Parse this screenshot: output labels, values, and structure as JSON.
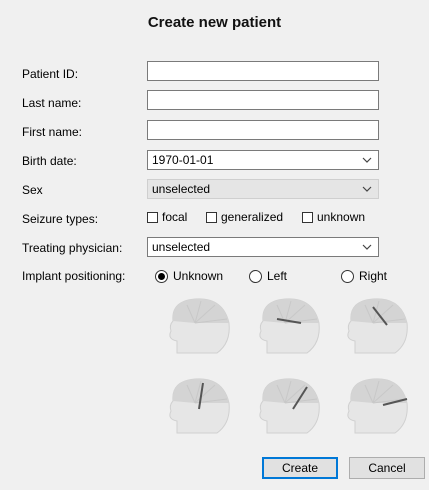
{
  "dialog": {
    "title": "Create new patient"
  },
  "form": {
    "patient_id": {
      "label": "Patient ID:",
      "value": ""
    },
    "last_name": {
      "label": "Last name:",
      "value": ""
    },
    "first_name": {
      "label": "First name:",
      "value": ""
    },
    "birth_date": {
      "label": "Birth date:",
      "value": "1970-01-01"
    },
    "sex": {
      "label": "Sex",
      "value": "unselected"
    },
    "seizure_types": {
      "label": "Seizure types:",
      "options": [
        {
          "label": "focal",
          "checked": false
        },
        {
          "label": "generalized",
          "checked": false
        },
        {
          "label": "unknown",
          "checked": false
        }
      ]
    },
    "treating_physician": {
      "label": "Treating physician:",
      "value": "unselected"
    },
    "implant_positioning": {
      "label": "Implant positioning:",
      "options": [
        {
          "label": "Unknown",
          "selected": true
        },
        {
          "label": "Left",
          "selected": false
        },
        {
          "label": "Right",
          "selected": false
        }
      ]
    }
  },
  "buttons": {
    "create": "Create",
    "cancel": "Cancel"
  },
  "icons": [
    "chevron-down-icon",
    "head-diagram-icon"
  ]
}
